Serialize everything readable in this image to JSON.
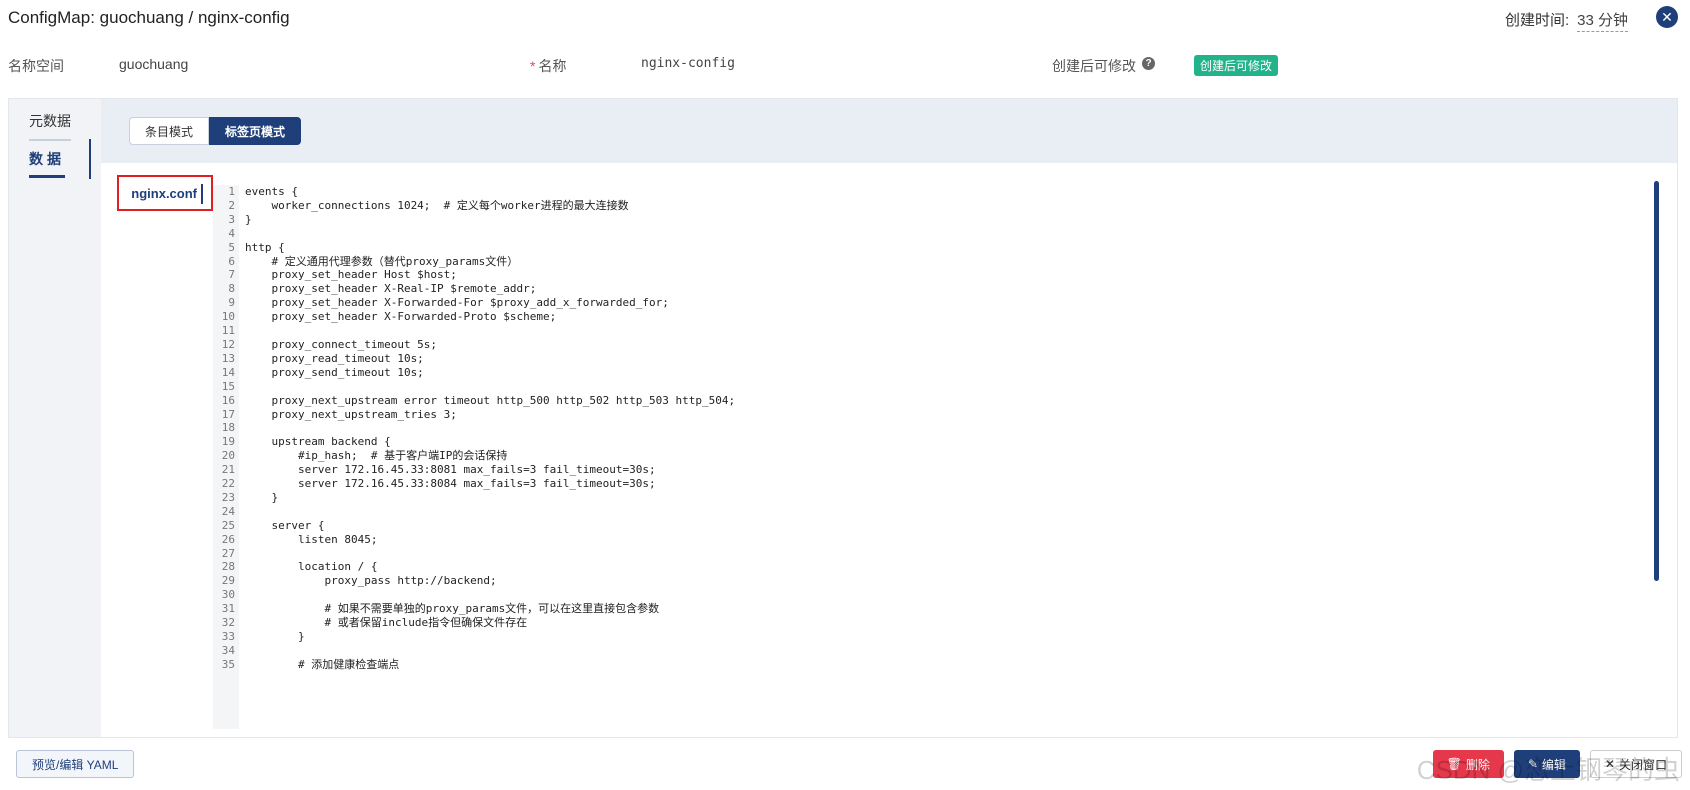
{
  "header": {
    "title": "ConfigMap: guochuang / nginx-config",
    "created_label": "创建时间:",
    "created_value": "33 分钟",
    "close_icon": "close-icon"
  },
  "meta": {
    "namespace_label": "名称空间",
    "namespace_value": "guochuang",
    "required_mark": "*",
    "name_label": "名称",
    "name_value": "nginx-config",
    "editable_label": "创建后可修改",
    "help_icon": "question-icon",
    "editable_badge": "创建后可修改"
  },
  "sidenav": {
    "items": [
      {
        "label": "元数据"
      },
      {
        "label": "数据"
      }
    ]
  },
  "modes": {
    "entry_mode": "条目模式",
    "tab_mode": "标签页模式"
  },
  "file_tab": {
    "label": "nginx.conf"
  },
  "editor": {
    "line_numbers": "1\n2\n3\n4\n5\n6\n7\n8\n9\n10\n11\n12\n13\n14\n15\n16\n17\n18\n19\n20\n21\n22\n23\n24\n25\n26\n27\n28\n29\n30\n31\n32\n33\n34\n35",
    "code": "events {\n    worker_connections 1024;  # 定义每个worker进程的最大连接数\n}\n\nhttp {\n    # 定义通用代理参数（替代proxy_params文件）\n    proxy_set_header Host $host;\n    proxy_set_header X-Real-IP $remote_addr;\n    proxy_set_header X-Forwarded-For $proxy_add_x_forwarded_for;\n    proxy_set_header X-Forwarded-Proto $scheme;\n\n    proxy_connect_timeout 5s;\n    proxy_read_timeout 10s;\n    proxy_send_timeout 10s;\n\n    proxy_next_upstream error timeout http_500 http_502 http_503 http_504;\n    proxy_next_upstream_tries 3;\n\n    upstream backend {\n        #ip_hash;  # 基于客户端IP的会话保持\n        server 172.16.45.33:8081 max_fails=3 fail_timeout=30s;\n        server 172.16.45.33:8084 max_fails=3 fail_timeout=30s;\n    }\n\n    server {\n        listen 8045;\n\n        location / {\n            proxy_pass http://backend;\n\n            # 如果不需要单独的proxy_params文件，可以在这里直接包含参数\n            # 或者保留include指令但确保文件存在\n        }\n\n        # 添加健康检查端点"
  },
  "footer": {
    "yaml_button": "预览/编辑 YAML",
    "delete_button": "删除",
    "edit_button": "编辑",
    "close_window_button": "关闭窗口",
    "watermark": "CSDN @恋上钢琴的虫"
  },
  "colors": {
    "primary": "#1f3f7a",
    "danger": "#e5384a",
    "badge": "#23b38b"
  }
}
